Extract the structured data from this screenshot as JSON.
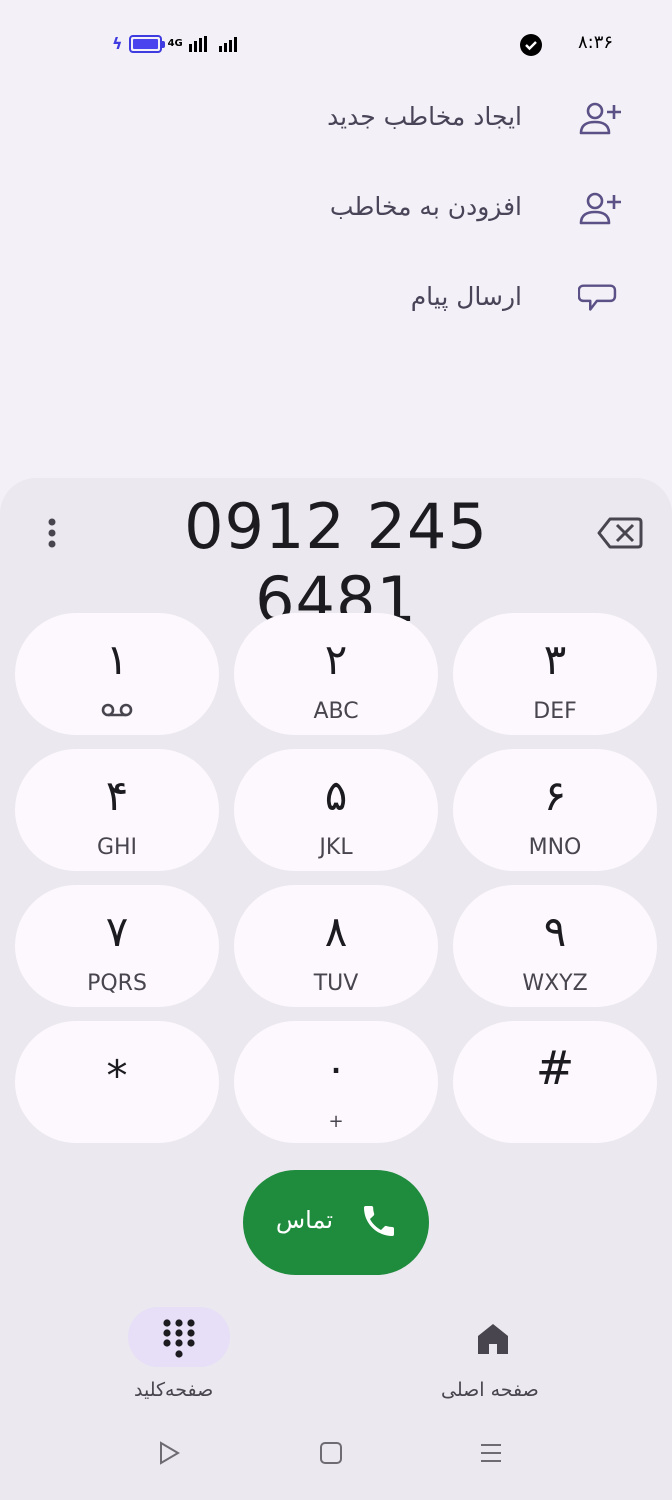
{
  "status_bar": {
    "time": "۸:۳۶",
    "network": "4G",
    "icons": [
      "charging-icon",
      "battery-icon",
      "signal-icon",
      "shield-icon"
    ]
  },
  "actions": [
    {
      "label": "ایجاد مخاطب جدید",
      "icon": "person-add-icon"
    },
    {
      "label": "افزودن به مخاطب",
      "icon": "person-add-icon"
    },
    {
      "label": "ارسال پیام",
      "icon": "message-icon"
    }
  ],
  "dialer": {
    "number": "0912 245 6481",
    "keys": [
      {
        "digit": "۱",
        "letters": "",
        "voicemail": true
      },
      {
        "digit": "۲",
        "letters": "ABC"
      },
      {
        "digit": "۳",
        "letters": "DEF"
      },
      {
        "digit": "۴",
        "letters": "GHI"
      },
      {
        "digit": "۵",
        "letters": "JKL"
      },
      {
        "digit": "۶",
        "letters": "MNO"
      },
      {
        "digit": "۷",
        "letters": "PQRS"
      },
      {
        "digit": "۸",
        "letters": "TUV"
      },
      {
        "digit": "۹",
        "letters": "WXYZ"
      },
      {
        "digit": "*",
        "letters": ""
      },
      {
        "digit": "۰",
        "letters": "+"
      },
      {
        "digit": "#",
        "letters": ""
      }
    ],
    "call_label": "تماس"
  },
  "bottom_nav": {
    "keypad_label": "صفحه‌کلید",
    "home_label": "صفحه اصلی"
  },
  "colors": {
    "accent": "#1e8b3d",
    "icon": "#5b5186",
    "background": "#f3f0f7",
    "sheet": "#ebe8ef",
    "key": "#fcf8fd"
  }
}
